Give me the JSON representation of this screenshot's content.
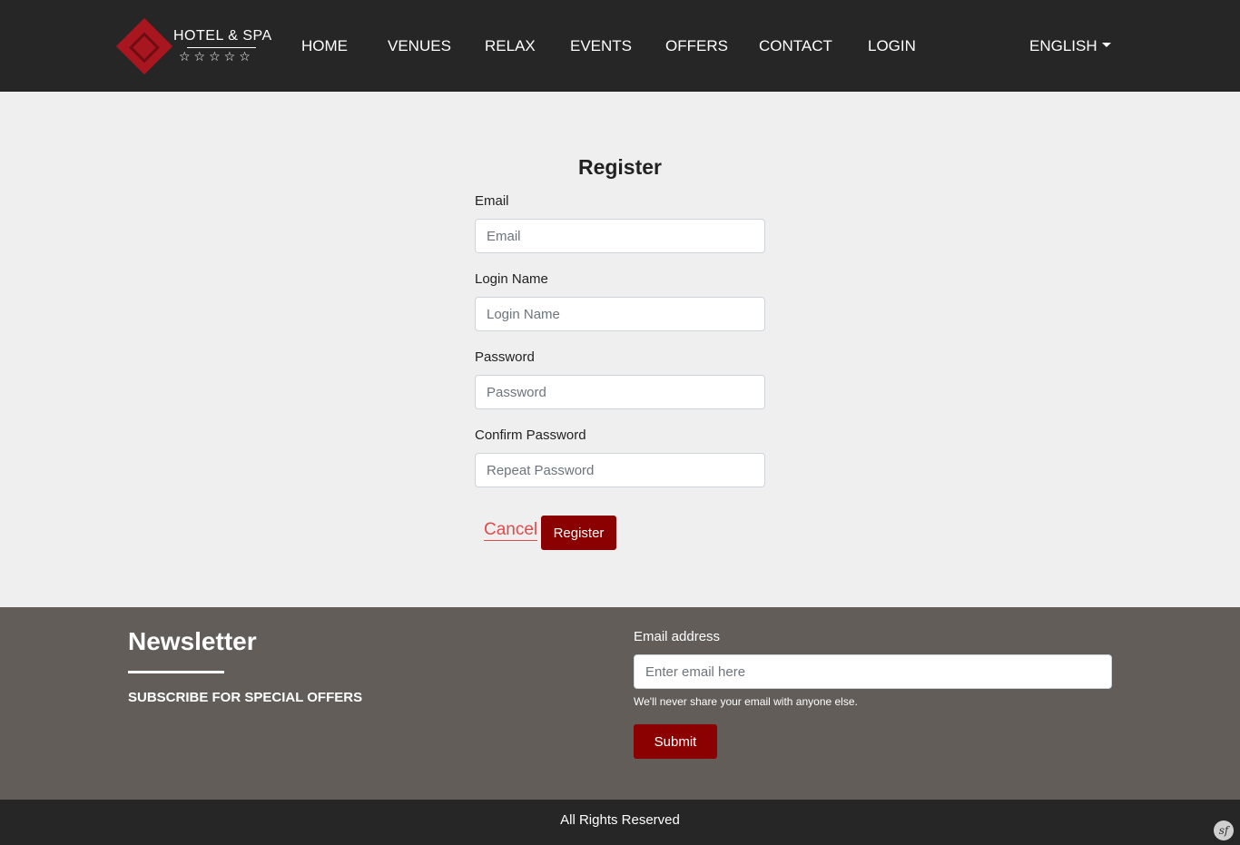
{
  "brand": {
    "name": "HOTEL & SPA",
    "stars": "☆☆☆☆☆",
    "logo_icon": "diamond-logo-icon"
  },
  "nav": {
    "items": [
      {
        "label": "HOME"
      },
      {
        "label": "VENUES"
      },
      {
        "label": "RELAX"
      },
      {
        "label": "EVENTS"
      },
      {
        "label": "OFFERS"
      },
      {
        "label": "CONTACT"
      },
      {
        "label": "LOGIN"
      }
    ],
    "language": "ENGLISH"
  },
  "register": {
    "title": "Register",
    "fields": {
      "email": {
        "label": "Email",
        "placeholder": "Email"
      },
      "login_name": {
        "label": "Login Name",
        "placeholder": "Login Name"
      },
      "password": {
        "label": "Password",
        "placeholder": "Password"
      },
      "confirm_password": {
        "label": "Confirm Password",
        "placeholder": "Repeat Password"
      }
    },
    "cancel_label": "Cancel",
    "submit_label": "Register"
  },
  "newsletter": {
    "title": "Newsletter",
    "subtitle": "SUBSCRIBE FOR SPECIAL OFFERS",
    "email_label": "Email address",
    "email_placeholder": "Enter email here",
    "help_text": "We'll never share your email with anyone else.",
    "submit_label": "Submit"
  },
  "footer": {
    "text": "All Rights Reserved",
    "corner_icon": "symfony-icon",
    "corner_glyph": "sf"
  },
  "colors": {
    "accent": "#8b0000",
    "navbar": "#262626",
    "newsletter_bg": "#625d59",
    "page_bg": "#efefef",
    "cancel": "#e04a4a"
  }
}
